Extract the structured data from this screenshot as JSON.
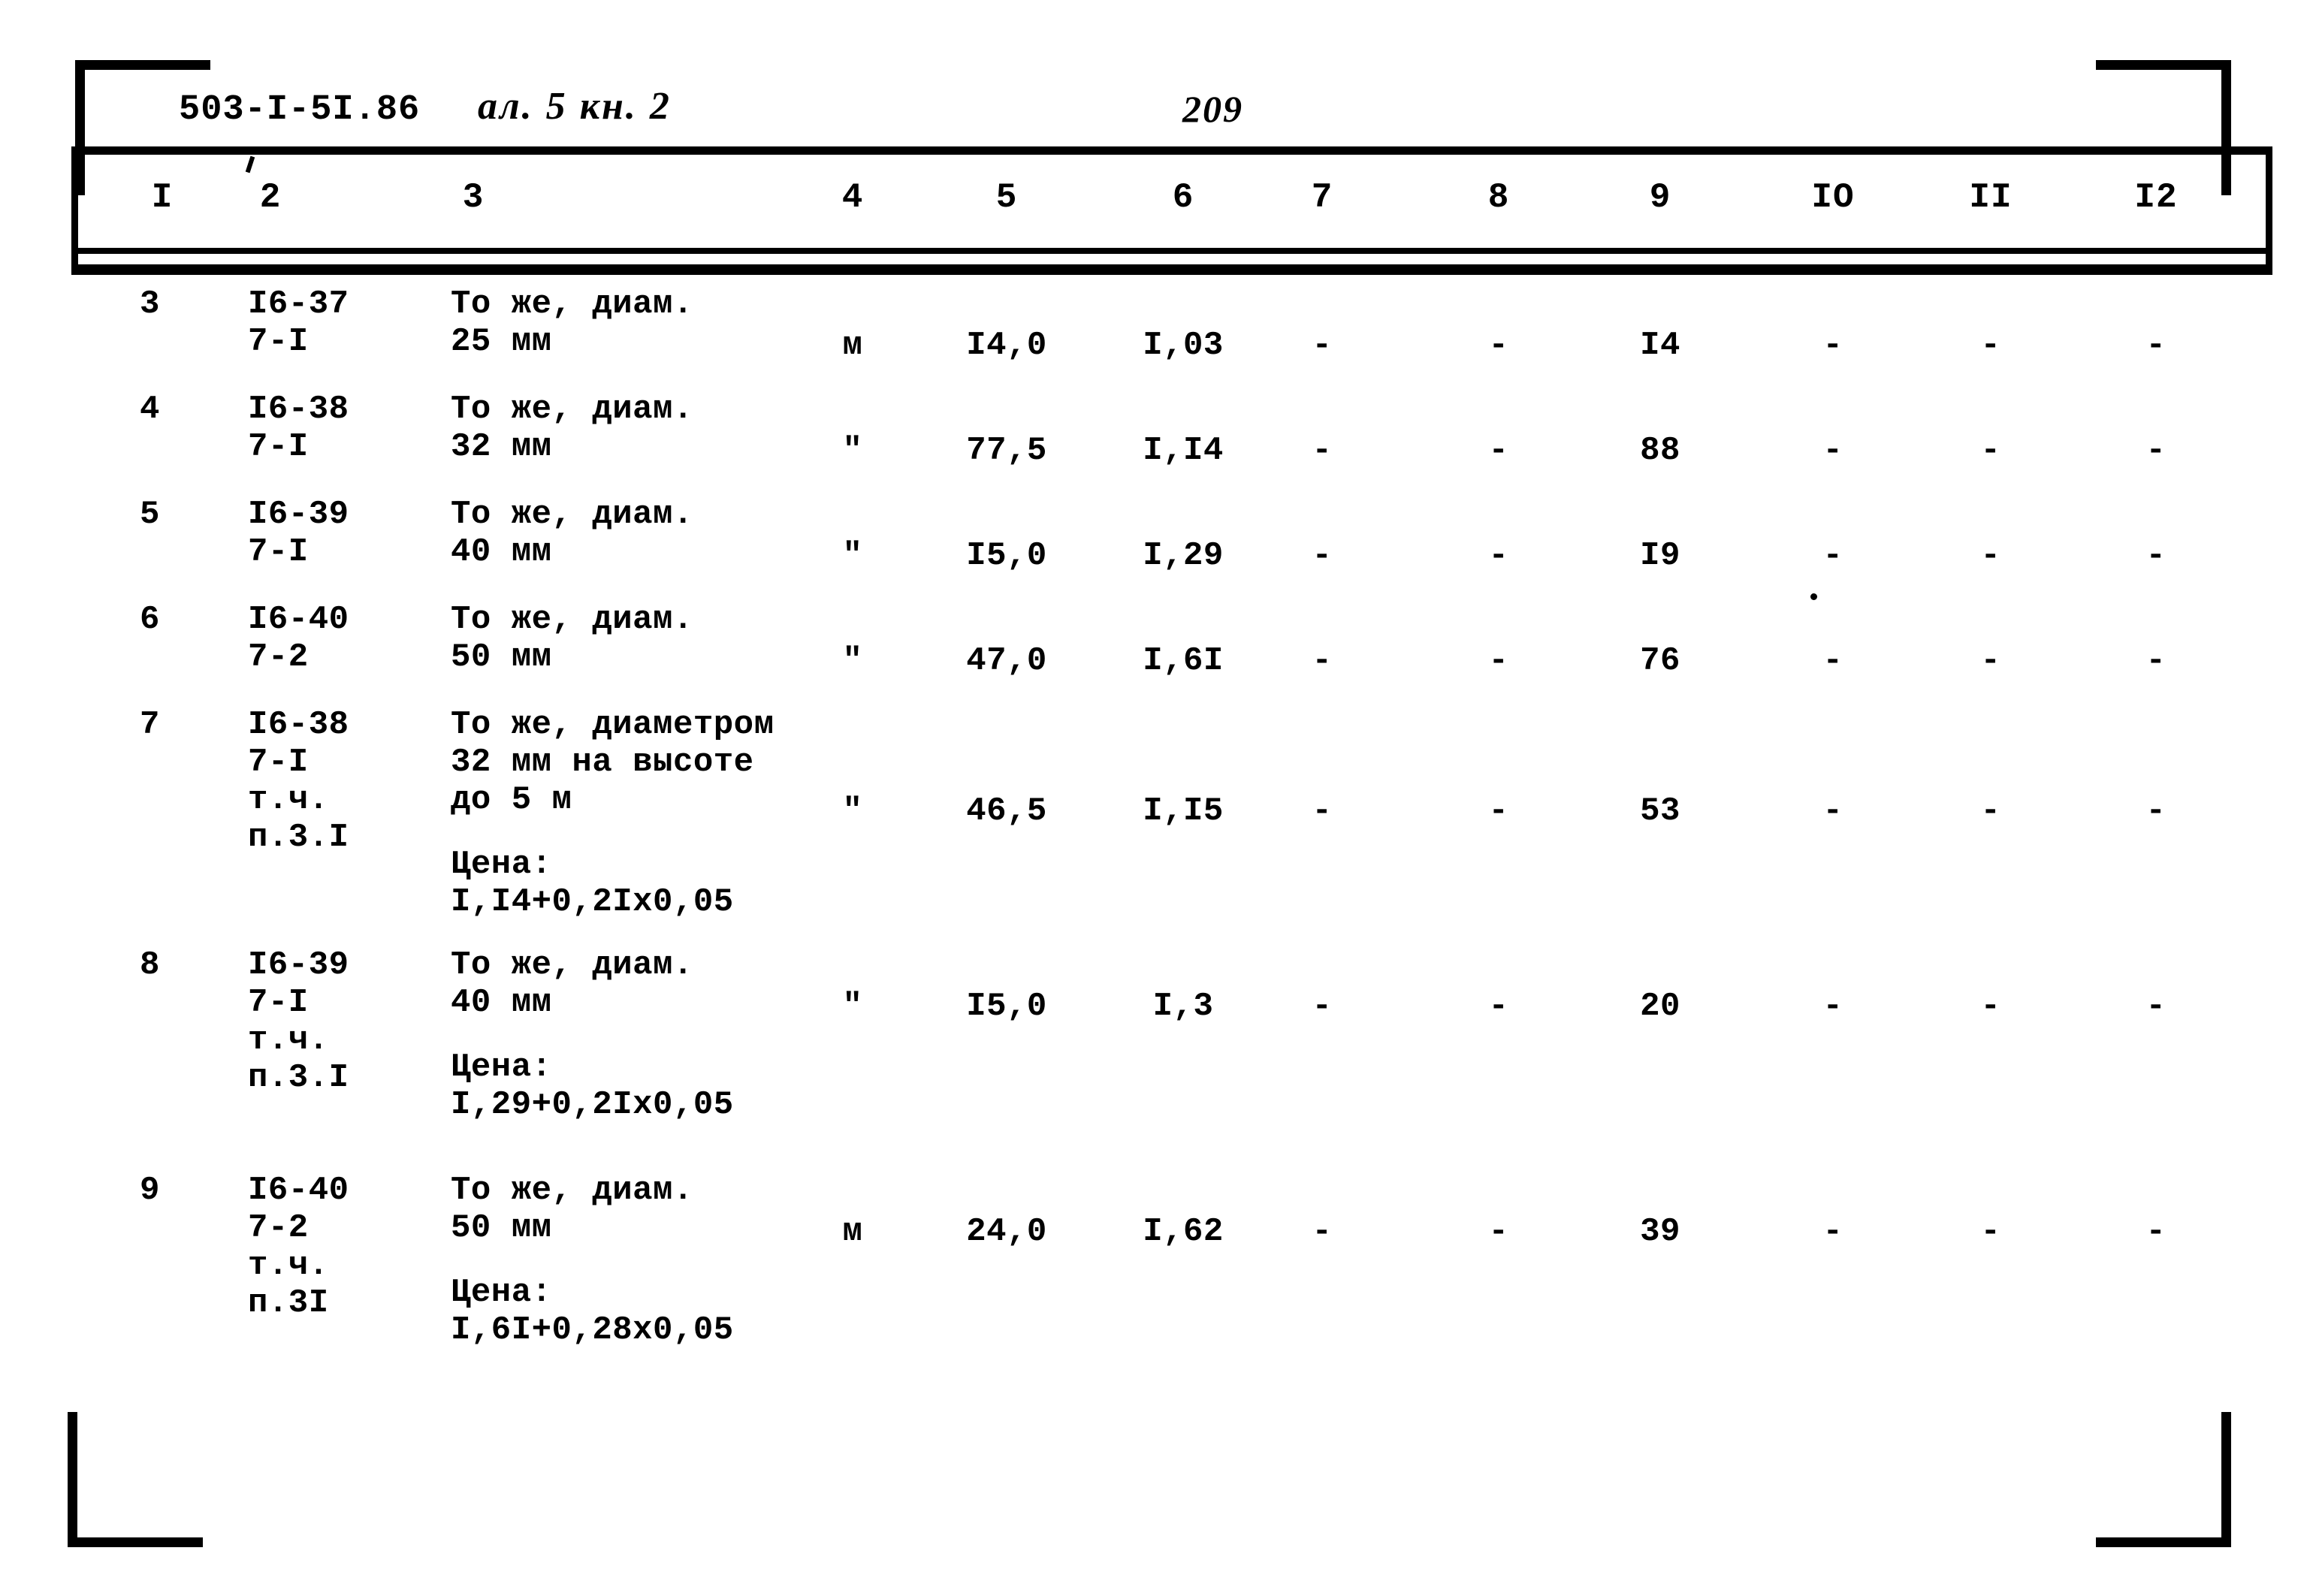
{
  "document": {
    "code": "503-I-5I.86",
    "handwritten_note": "ал. 5 кн. 2",
    "page_number": "209"
  },
  "table": {
    "column_numbers": [
      "I",
      "2",
      "3",
      "4",
      "5",
      "6",
      "7",
      "8",
      "9",
      "IO",
      "II",
      "I2"
    ],
    "rows": [
      {
        "n": "3",
        "code": "I6-37\n7-I",
        "description": "То же, диам.\n25 мм",
        "unit": "м",
        "c5": "I4,0",
        "c6": "I,03",
        "c7": "-",
        "c8": "-",
        "c9": "I4",
        "c10": "-",
        "c11": "-",
        "c12": "-",
        "price": ""
      },
      {
        "n": "4",
        "code": "I6-38\n7-I",
        "description": "То же, диам.\n32 мм",
        "unit": "\"",
        "c5": "77,5",
        "c6": "I,I4",
        "c7": "-",
        "c8": "-",
        "c9": "88",
        "c10": "-",
        "c11": "-",
        "c12": "-",
        "price": ""
      },
      {
        "n": "5",
        "code": "I6-39\n7-I",
        "description": "То же, диам.\n40 мм",
        "unit": "\"",
        "c5": "I5,0",
        "c6": "I,29",
        "c7": "-",
        "c8": "-",
        "c9": "I9",
        "c10": "-",
        "c11": "-",
        "c12": "-",
        "price": ""
      },
      {
        "n": "6",
        "code": "I6-40\n7-2",
        "description": "То же, диам.\n50 мм",
        "unit": "\"",
        "c5": "47,0",
        "c6": "I,6I",
        "c7": "-",
        "c8": "-",
        "c9": "76",
        "c10": "-",
        "c11": "-",
        "c12": "-",
        "price": ""
      },
      {
        "n": "7",
        "code": "I6-38\n7-I\nт.ч.\nп.3.I",
        "description": "То же, диаметром\n32 мм на высоте\nдо 5 м",
        "unit": "\"",
        "c5": "46,5",
        "c6": "I,I5",
        "c7": "-",
        "c8": "-",
        "c9": "53",
        "c10": "-",
        "c11": "-",
        "c12": "-",
        "price": "Цена:\nI,I4+0,2Iх0,05"
      },
      {
        "n": "8",
        "code": "I6-39\n7-I\nт.ч.\nп.3.I",
        "description": "То же, диам.\n40 мм",
        "unit": "\"",
        "c5": "I5,0",
        "c6": "I,3",
        "c7": "-",
        "c8": "-",
        "c9": "20",
        "c10": "-",
        "c11": "-",
        "c12": "-",
        "price": "Цена:\nI,29+0,2Iх0,05"
      },
      {
        "n": "9",
        "code": "I6-40\n7-2\nт.ч.\nп.3I",
        "description": "То же, диам.\n50 мм",
        "unit": "м",
        "c5": "24,0",
        "c6": "I,62",
        "c7": "-",
        "c8": "-",
        "c9": "39",
        "c10": "-",
        "c11": "-",
        "c12": "-",
        "price": "Цена:\nI,6I+0,28х0,05"
      }
    ]
  }
}
